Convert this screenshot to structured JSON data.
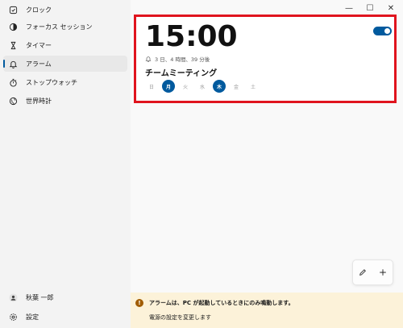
{
  "sidebar": {
    "items": [
      {
        "label": "クロック",
        "icon": "clock-icon"
      },
      {
        "label": "フォーカス セッション",
        "icon": "focus-icon"
      },
      {
        "label": "タイマー",
        "icon": "hourglass-icon"
      },
      {
        "label": "アラーム",
        "icon": "bell-icon",
        "selected": true
      },
      {
        "label": "ストップウォッチ",
        "icon": "stopwatch-icon"
      },
      {
        "label": "世界時計",
        "icon": "globe-icon"
      }
    ],
    "user": {
      "label": "秋葉 一郎",
      "icon": "person-icon"
    },
    "settings": {
      "label": "設定",
      "icon": "gear-icon"
    }
  },
  "titlebar": {
    "minimize": "—",
    "maximize": "☐",
    "close": "✕"
  },
  "alarm": {
    "time": "15:00",
    "countdown": "3 日、4 時間、39 分後",
    "name": "チームミーティング",
    "enabled": true,
    "days": [
      {
        "label": "日",
        "active": false
      },
      {
        "label": "月",
        "active": true
      },
      {
        "label": "火",
        "active": false
      },
      {
        "label": "水",
        "active": false
      },
      {
        "label": "木",
        "active": true
      },
      {
        "label": "金",
        "active": false
      },
      {
        "label": "土",
        "active": false
      }
    ]
  },
  "actions": {
    "edit_icon": "pencil-icon",
    "add_icon": "plus-icon"
  },
  "infobar": {
    "icon_glyph": "!",
    "message": "アラームは、PC が起動しているときにのみ鳴動します。",
    "link": "電源の設定を変更します"
  },
  "colors": {
    "accent": "#005a9e",
    "highlight": "#e0141e",
    "info_background": "#fcf2d9"
  }
}
